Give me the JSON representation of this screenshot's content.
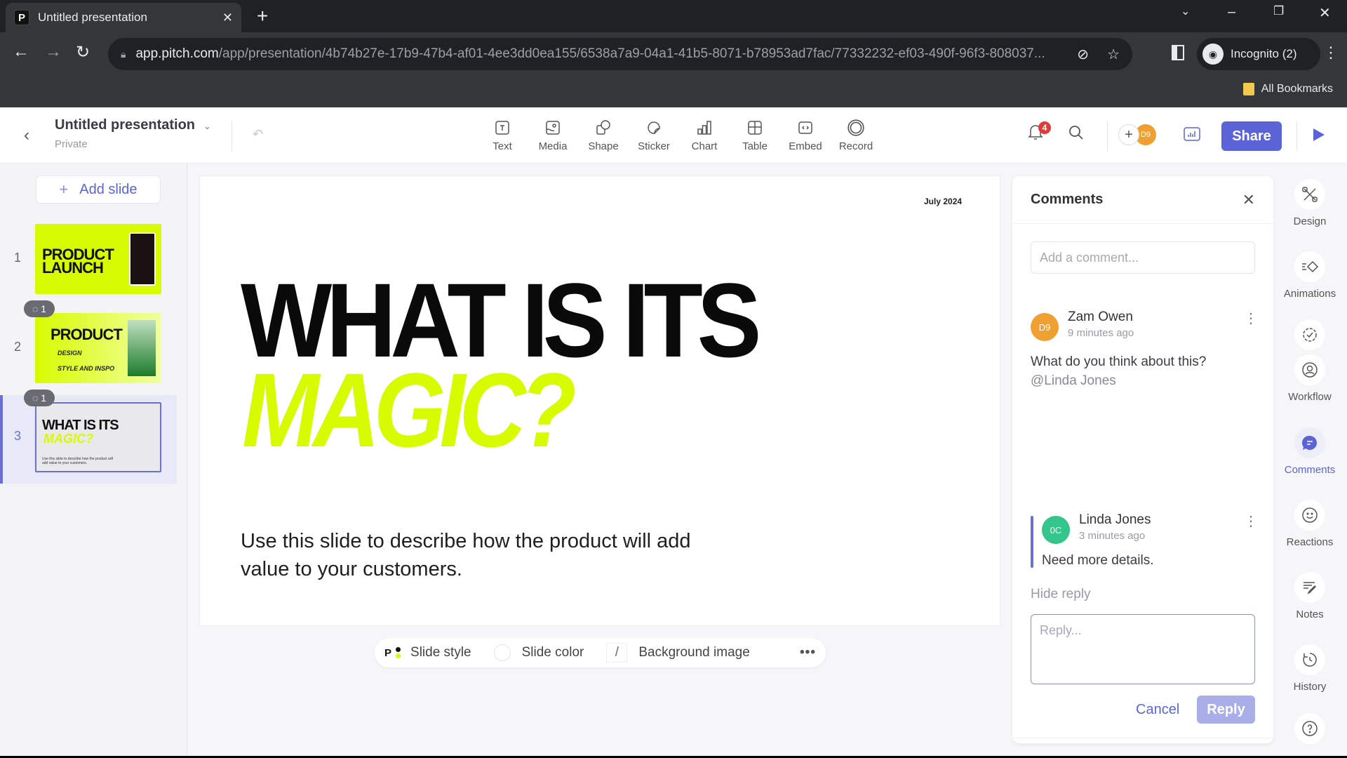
{
  "browser": {
    "tab_title": "Untitled presentation",
    "favicon_letter": "P",
    "url_host": "app.pitch.com",
    "url_path": "/app/presentation/4b74b27e-17b9-47b4-af01-4ee3dd0ea155/6538a7a9-04a1-41b5-8071-b78953ad7fac/77332232-ef03-490f-96f3-808037...",
    "profile_label": "Incognito (2)",
    "bookmarks_label": "All Bookmarks"
  },
  "header": {
    "doc_title": "Untitled presentation",
    "privacy": "Private",
    "tools": [
      {
        "label": "Text",
        "icon": "text-icon"
      },
      {
        "label": "Media",
        "icon": "media-icon"
      },
      {
        "label": "Shape",
        "icon": "shape-icon"
      },
      {
        "label": "Sticker",
        "icon": "sticker-icon"
      },
      {
        "label": "Chart",
        "icon": "chart-icon"
      },
      {
        "label": "Table",
        "icon": "table-icon"
      },
      {
        "label": "Embed",
        "icon": "embed-icon"
      },
      {
        "label": "Record",
        "icon": "record-icon"
      }
    ],
    "notification_count": "4",
    "collaborator_initials": "D9",
    "share_label": "Share"
  },
  "sidebar": {
    "add_slide_label": "Add slide",
    "slides": [
      {
        "number": "1",
        "title": "PRODUCT LAUNCH",
        "comment_count": null
      },
      {
        "number": "2",
        "title": "PRODUCT",
        "subtitle_1": "DESIGN",
        "subtitle_2": "STYLE AND INSPO",
        "comment_count": "1"
      },
      {
        "number": "3",
        "title": "WHAT IS ITS",
        "accent": "MAGIC?",
        "desc": "Use this slide to describe how the product will add value to your customers.",
        "comment_count": "1",
        "active": true
      }
    ]
  },
  "slide": {
    "date": "July 2024",
    "headline_1": "WHAT IS ITS",
    "headline_2": "MAGIC?",
    "description": "Use this slide to describe how the product will add value to your customers.",
    "accent_color": "#d7fb00"
  },
  "slide_toolbar": {
    "style_letter": "P",
    "slide_style_label": "Slide style",
    "slide_color_label": "Slide color",
    "background_image_label": "Background image",
    "more_label": "•••"
  },
  "comments": {
    "title": "Comments",
    "add_placeholder": "Add a comment...",
    "thread": [
      {
        "initials": "D9",
        "avatar_color": "#f0a030",
        "author": "Zam Owen",
        "time": "9 minutes ago",
        "text": "What do you think about this?",
        "mention": "@Linda Jones"
      },
      {
        "initials": "0C",
        "avatar_color": "#33c58a",
        "author": "Linda Jones",
        "time": "3 minutes ago",
        "text": "Need more details."
      }
    ],
    "hide_reply_label": "Hide reply",
    "reply_placeholder": "Reply...",
    "cancel_label": "Cancel",
    "reply_label": "Reply"
  },
  "rail": {
    "items": [
      {
        "label": "Design"
      },
      {
        "label": "Animations"
      },
      {
        "label": "Workflow"
      },
      {
        "label": "Comments",
        "active": true
      },
      {
        "label": "Reactions"
      },
      {
        "label": "Notes"
      },
      {
        "label": "History"
      }
    ]
  },
  "colors": {
    "brand": "#5b64d6",
    "accent": "#d7fb00"
  }
}
